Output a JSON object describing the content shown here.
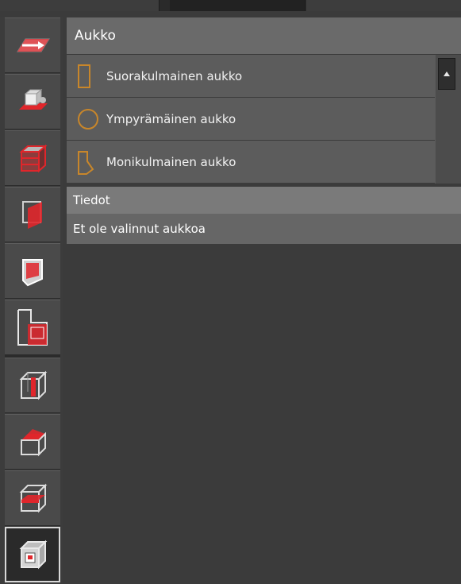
{
  "panel": {
    "title": "Aukko",
    "opening_types": [
      {
        "label": "Suorakulmainen aukko",
        "icon": "rectangle-opening-icon"
      },
      {
        "label": "Ympyrämäinen aukko",
        "icon": "circle-opening-icon"
      },
      {
        "label": "Monikulmainen aukko",
        "icon": "polygon-opening-icon"
      }
    ]
  },
  "info": {
    "header": "Tiedot",
    "message": "Et ole valinnut aukkoa"
  },
  "toolbar": {
    "tools": [
      {
        "icon": "arrow-into-slab-icon"
      },
      {
        "icon": "cut-box-icon"
      },
      {
        "icon": "layered-block-icon"
      },
      {
        "icon": "wall-face-icon"
      },
      {
        "icon": "wall-opening-icon"
      },
      {
        "icon": "l-shape-opening-icon"
      },
      {
        "icon": "box-vertical-cut-icon"
      },
      {
        "icon": "box-roof-icon"
      },
      {
        "icon": "box-horizontal-cut-icon"
      },
      {
        "icon": "box-opening-icon",
        "selected": true
      }
    ]
  },
  "colors": {
    "accent_red": "#e0262b",
    "icon_orange": "#c8862a",
    "panel_header": "#6a6a6a",
    "list_item": "#5c5c5c",
    "background": "#3b3b3b"
  }
}
